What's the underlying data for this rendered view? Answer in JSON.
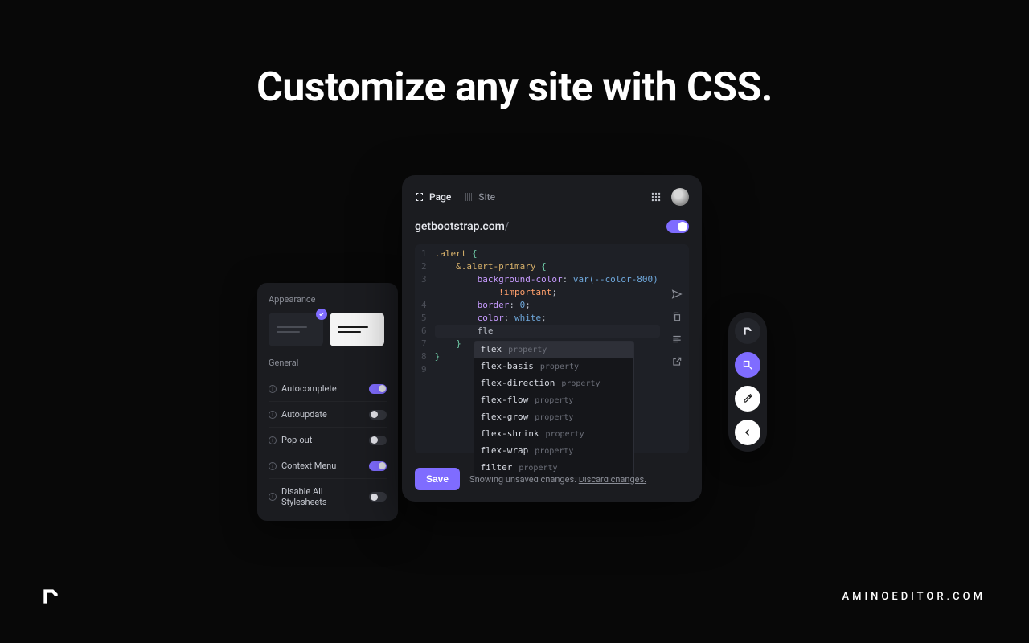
{
  "hero": {
    "title": "Customize any site with CSS."
  },
  "footer_url": "AMINOEDITOR.COM",
  "settings": {
    "appearance_label": "Appearance",
    "general_label": "General",
    "rows": [
      {
        "label": "Autocomplete",
        "on": true
      },
      {
        "label": "Autoupdate",
        "on": false
      },
      {
        "label": "Pop-out",
        "on": false
      },
      {
        "label": "Context Menu",
        "on": true
      },
      {
        "label": "Disable All Stylesheets",
        "on": false
      }
    ]
  },
  "editor": {
    "tabs": {
      "page": "Page",
      "site": "Site"
    },
    "url_display": "getbootstrap.com",
    "url_slash": "/",
    "save_label": "Save",
    "footer_text": "Showing unsaved changes. ",
    "footer_link": "Discard changes.",
    "code_lines": [
      {
        "n": "1",
        "html": "<span class='c-sel'>.alert</span> <span class='c-punc'>{</span>"
      },
      {
        "n": "2",
        "html": "    <span class='c-sel'>&amp;.alert-primary</span> <span class='c-punc'>{</span>"
      },
      {
        "n": "3",
        "html": "        <span class='c-prop'>background-color</span>: <span class='c-val'>var(--color-800)</span>"
      },
      {
        "n": "",
        "html": "            <span class='c-kw'>!important</span>;"
      },
      {
        "n": "4",
        "html": "        <span class='c-prop'>border</span>: <span class='c-val'>0</span>;"
      },
      {
        "n": "5",
        "html": "        <span class='c-prop'>color</span>: <span class='c-val'>white</span>;"
      },
      {
        "n": "6",
        "html": "        fle",
        "cursor": true
      },
      {
        "n": "7",
        "html": "    <span class='c-punc'>}</span>"
      },
      {
        "n": "8",
        "html": "<span class='c-punc'>}</span>"
      },
      {
        "n": "9",
        "html": ""
      }
    ],
    "autocomplete": [
      {
        "name": "flex",
        "type": "property",
        "sel": true
      },
      {
        "name": "flex-basis",
        "type": "property"
      },
      {
        "name": "flex-direction",
        "type": "property"
      },
      {
        "name": "flex-flow",
        "type": "property"
      },
      {
        "name": "flex-grow",
        "type": "property"
      },
      {
        "name": "flex-shrink",
        "type": "property"
      },
      {
        "name": "flex-wrap",
        "type": "property"
      },
      {
        "name": "filter",
        "type": "property"
      }
    ]
  }
}
